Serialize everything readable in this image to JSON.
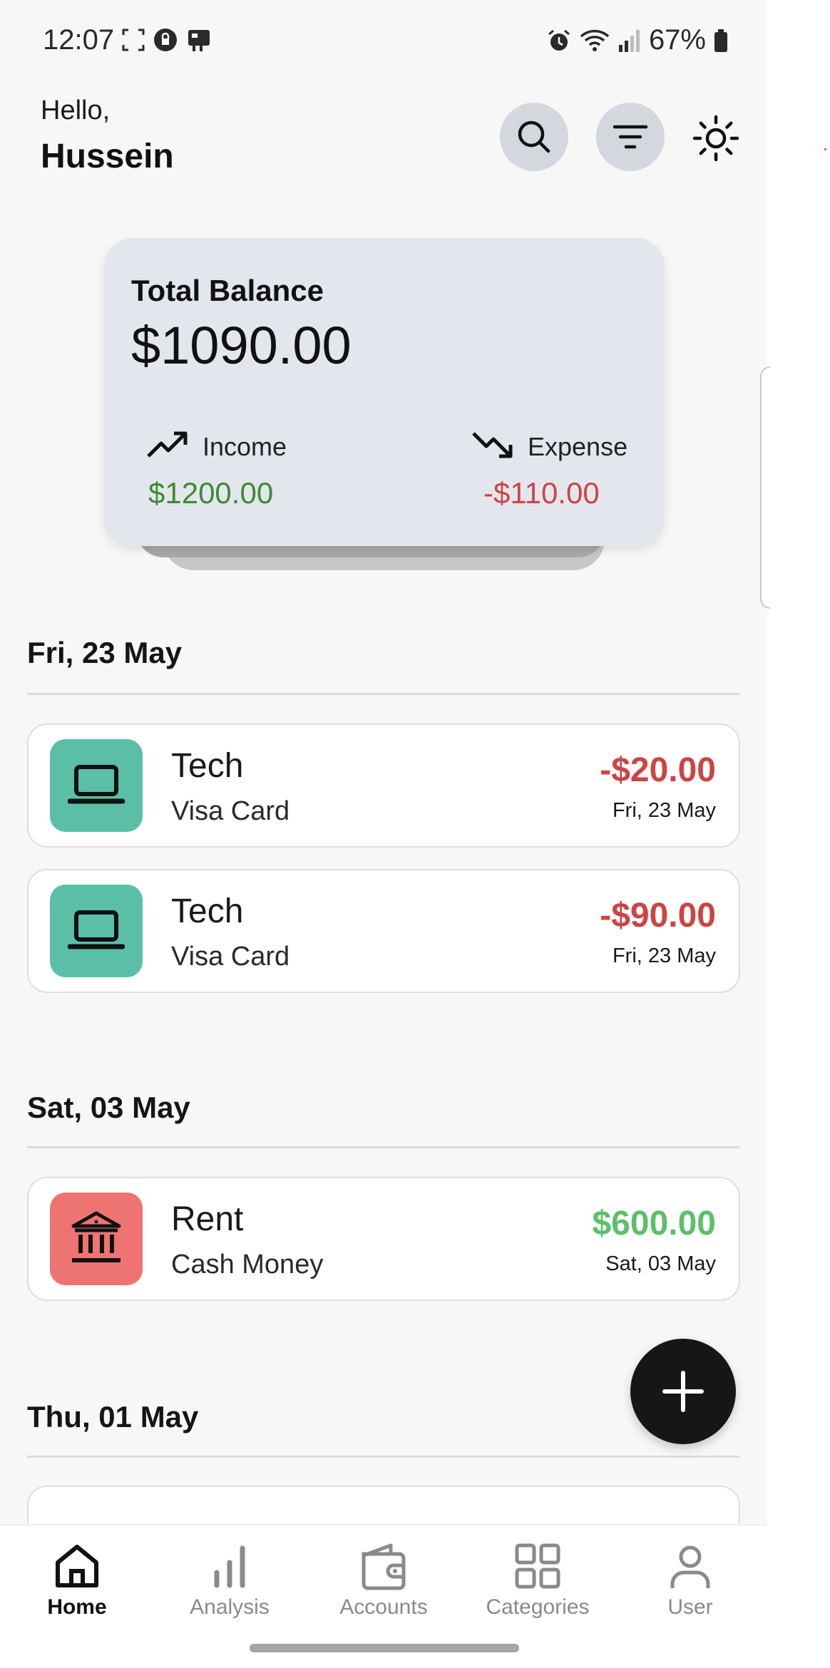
{
  "status_bar": {
    "time": "12:07",
    "battery": "67%"
  },
  "header": {
    "greeting": "Hello,",
    "username": "Hussein"
  },
  "balance_card": {
    "label": "Total Balance",
    "amount": "$1090.00",
    "income_label": "Income",
    "income_amount": "$1200.00",
    "expense_label": "Expense",
    "expense_amount": "-$110.00"
  },
  "sections": [
    {
      "date": "Fri, 23 May",
      "transactions": [
        {
          "title": "Tech",
          "account": "Visa Card",
          "amount": "-$20.00",
          "date": "Fri, 23 May",
          "icon": "laptop-icon"
        },
        {
          "title": "Tech",
          "account": "Visa Card",
          "amount": "-$90.00",
          "date": "Fri, 23 May",
          "icon": "laptop-icon"
        }
      ]
    },
    {
      "date": "Sat, 03 May",
      "transactions": [
        {
          "title": "Rent",
          "account": "Cash Money",
          "amount": "$600.00",
          "date": "Sat, 03 May",
          "icon": "bank-icon"
        }
      ]
    },
    {
      "date": "Thu, 01 May",
      "transactions": []
    }
  ],
  "nav": [
    {
      "label": "Home",
      "icon": "home-icon",
      "active": true
    },
    {
      "label": "Analysis",
      "icon": "bar-chart-icon",
      "active": false
    },
    {
      "label": "Accounts",
      "icon": "wallet-icon",
      "active": false
    },
    {
      "label": "Categories",
      "icon": "grid-icon",
      "active": false
    },
    {
      "label": "User",
      "icon": "user-icon",
      "active": false
    }
  ],
  "colors": {
    "income": "#3d8b2f",
    "expense": "#cc4444",
    "positive_tx": "#5cbf6a",
    "tech_icon_bg": "#5bbfa8",
    "rent_icon_bg": "#ee7472",
    "card_bg": "#e4e6ee",
    "fab_bg": "#161616"
  }
}
